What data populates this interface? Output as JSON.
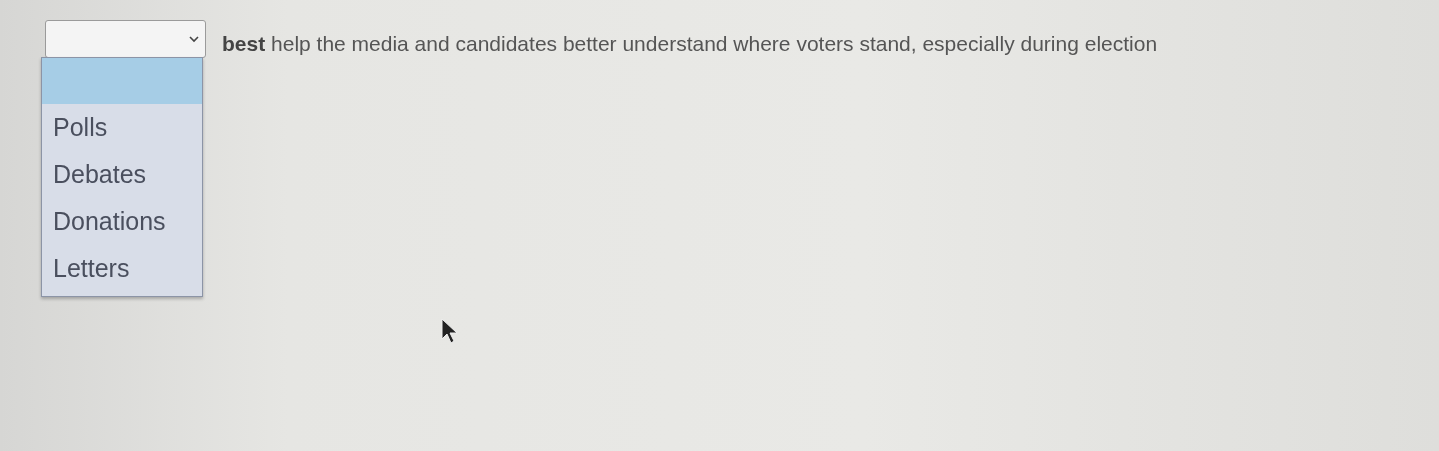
{
  "dropdown": {
    "expanded": true,
    "options": [
      {
        "selected": true
      },
      {
        "label": "Polls",
        "selected": false
      },
      {
        "label": "Debates",
        "selected": false
      },
      {
        "label": "Donations",
        "selected": false
      },
      {
        "label": "Letters",
        "selected": false
      }
    ]
  },
  "sentence": "**best** help the media and candidates better understand where voters stand, especially during election"
}
